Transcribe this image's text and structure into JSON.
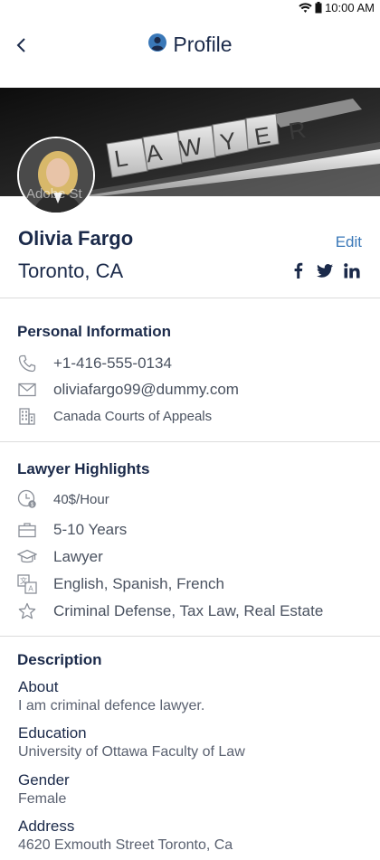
{
  "status": {
    "time": "10:00 AM",
    "wifi_icon": "wifi-icon",
    "battery_icon": "battery-icon"
  },
  "header": {
    "title": "Profile",
    "back_icon": "chevron-left-icon",
    "profile_icon": "user-circle-icon"
  },
  "cover": {
    "board_text": "LAWYER",
    "watermark": "Adobe St"
  },
  "profile": {
    "name": "Olivia Fargo",
    "city": "Toronto, CA",
    "edit_label": "Edit",
    "socials": [
      "f",
      "twitter",
      "in"
    ]
  },
  "personal": {
    "title": "Personal Information",
    "phone": "+1-416-555-0134",
    "email": "oliviafargo99@dummy.com",
    "court": "Canada Courts of Appeals"
  },
  "highlights": {
    "title": "Lawyer Highlights",
    "rate": "40$/Hour",
    "experience": "5-10 Years",
    "role": "Lawyer",
    "languages": "English, Spanish, French",
    "practice": "Criminal Defense, Tax Law, Real Estate"
  },
  "description": {
    "title": "Description",
    "about_label": "About",
    "about_value": "I am criminal defence lawyer.",
    "education_label": "Education",
    "education_value": "University of Ottawa Faculty of Law",
    "gender_label": "Gender",
    "gender_value": "Female",
    "address_label": "Address",
    "address_value": "4620  Exmouth Street Toronto, Ca"
  },
  "colors": {
    "primary_text": "#1b2a4a",
    "link": "#3a78b8",
    "muted": "#8a8f98",
    "divider": "#dcdcdc"
  }
}
